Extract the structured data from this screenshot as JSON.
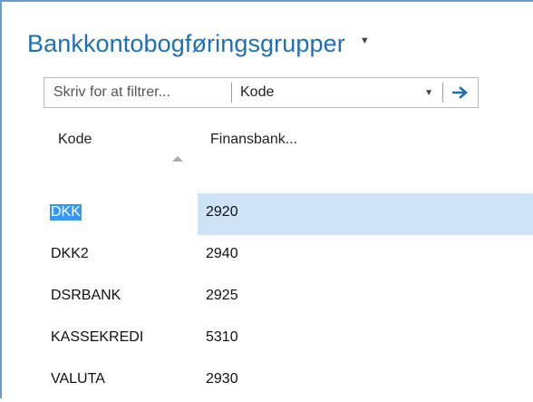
{
  "page": {
    "title": "Bankkontobogføringsgrupper"
  },
  "filter": {
    "placeholder": "Skriv for at filtrer...",
    "field_value": "Kode"
  },
  "columns": {
    "code": "Kode",
    "account": "Finansbank..."
  },
  "rows": [
    {
      "code": "DKK",
      "account": "2920",
      "selected": true
    },
    {
      "code": "DKK2",
      "account": "2940"
    },
    {
      "code": "DSRBANK",
      "account": "2925"
    },
    {
      "code": "KASSEKREDI",
      "account": "5310"
    },
    {
      "code": "VALUTA",
      "account": "2930"
    }
  ],
  "colors": {
    "title": "#1d6fb8",
    "selected_row": "#cfe3f6",
    "selected_text_highlight": "#3399ff"
  },
  "icons": {
    "title_menu": "chevron-down-icon",
    "field_dropdown": "chevron-down-icon",
    "apply_filter": "arrow-right-icon",
    "sort": "sort-ascending-icon"
  }
}
